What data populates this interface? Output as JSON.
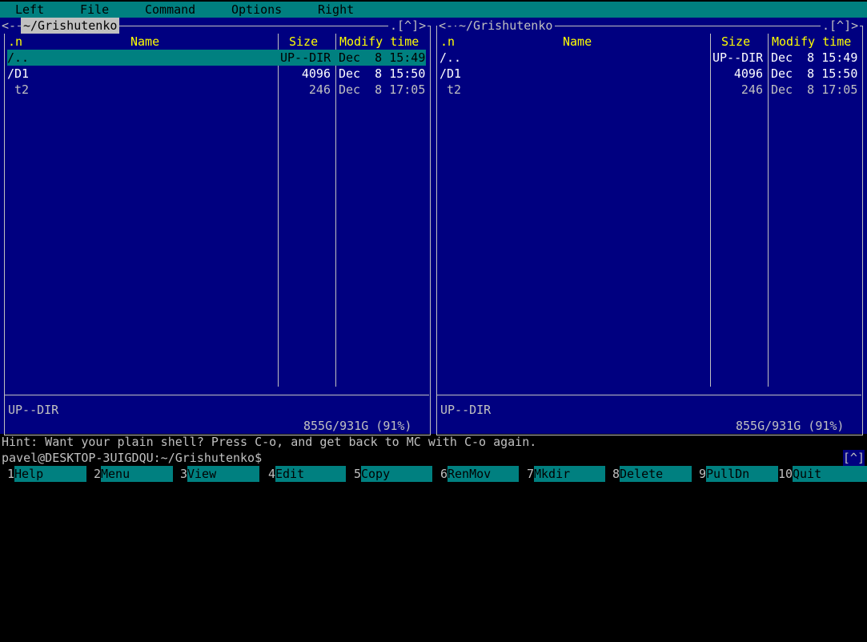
{
  "menubar": {
    "items": [
      {
        "label": "Left"
      },
      {
        "label": "File"
      },
      {
        "label": "Command"
      },
      {
        "label": "Options"
      },
      {
        "label": "Right"
      }
    ]
  },
  "panels": {
    "left": {
      "title": "~/Grishutenko",
      "left_arrows": "<-",
      "corner": ".[^]>",
      "headers": {
        "sort": ".n",
        "name": "Name",
        "size": "Size",
        "modify": "Modify time"
      },
      "rows": [
        {
          "name": "/..",
          "size": "UP--DIR",
          "time": "Dec  8 15:49"
        },
        {
          "name": "/D1",
          "size": "4096",
          "time": "Dec  8 15:50"
        },
        {
          "name": " t2",
          "size": "246",
          "time": "Dec  8 17:05"
        }
      ],
      "info": "UP--DIR",
      "free": "855G/931G (91%)"
    },
    "right": {
      "title": "~/Grishutenko",
      "left_arrows": "<- ",
      "corner": ".[^]>",
      "headers": {
        "sort": ".n",
        "name": "Name",
        "size": "Size",
        "modify": "Modify time"
      },
      "rows": [
        {
          "name": "/..",
          "size": "UP--DIR",
          "time": "Dec  8 15:49"
        },
        {
          "name": "/D1",
          "size": "4096",
          "time": "Dec  8 15:50"
        },
        {
          "name": " t2",
          "size": "246",
          "time": "Dec  8 17:05"
        }
      ],
      "info": "UP--DIR",
      "free": "855G/931G (91%)"
    }
  },
  "hint": "Hint: Want your plain shell? Press C-o, and get back to MC with C-o again.",
  "prompt": "pavel@DESKTOP-3UIGDQU:~/Grishutenko$",
  "prompt_indicator": "[^]",
  "fkeys": [
    {
      "num": "1",
      "label": "Help"
    },
    {
      "num": "2",
      "label": "Menu"
    },
    {
      "num": "3",
      "label": "View"
    },
    {
      "num": "4",
      "label": "Edit"
    },
    {
      "num": "5",
      "label": "Copy"
    },
    {
      "num": "6",
      "label": "RenMov"
    },
    {
      "num": "7",
      "label": "Mkdir"
    },
    {
      "num": "8",
      "label": "Delete"
    },
    {
      "num": "9",
      "label": "PullDn"
    },
    {
      "num": "10",
      "label": "Quit"
    }
  ],
  "colors": {
    "panel_bg": "#000080",
    "accent": "#008080",
    "header_text": "#ffff00",
    "frame": "#c0c0c0"
  }
}
